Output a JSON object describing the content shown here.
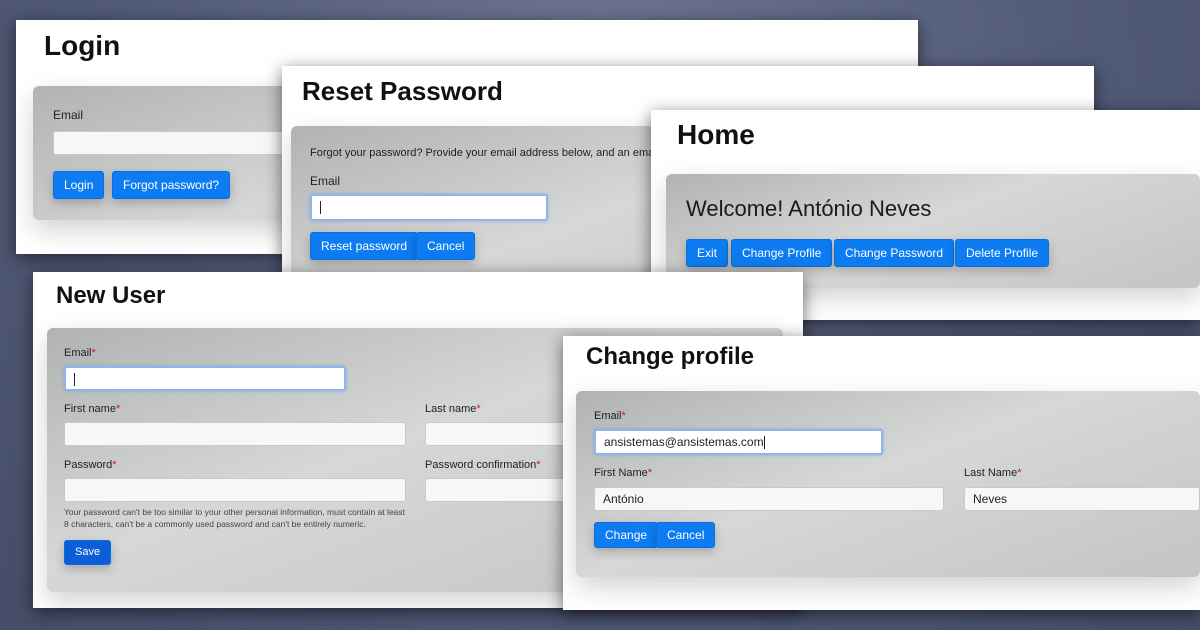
{
  "login": {
    "title": "Login",
    "email_label": "Email",
    "email_value": "",
    "login_button": "Login",
    "forgot_button": "Forgot password?"
  },
  "reset_password": {
    "title": "Reset Password",
    "description": "Forgot your password? Provide your email address below, and an ema",
    "email_label": "Email",
    "email_value": "",
    "reset_button": "Reset password",
    "cancel_button": "Cancel"
  },
  "home": {
    "title": "Home",
    "welcome": "Welcome! António Neves",
    "exit_button": "Exit",
    "change_profile_button": "Change Profile",
    "change_password_button": "Change Password",
    "delete_profile_button": "Delete Profile"
  },
  "new_user": {
    "title": "New User",
    "email_label": "Email",
    "first_name_label": "First name",
    "last_name_label": "Last name",
    "password_label": "Password",
    "password_confirmation_label": "Password confirmation",
    "required_mark": "*",
    "password_help_line1": "Your password can't be too similar to your other personal information, must contain at least",
    "password_help_line2": "8 characters, can't be a commonly used password and can't be entirely numeric.",
    "save_button": "Save"
  },
  "change_profile": {
    "title": "Change profile",
    "email_label": "Email",
    "email_value": "ansistemas@ansistemas.com",
    "first_name_label": "First Name",
    "first_name_value": "António",
    "last_name_label": "Last Name",
    "last_name_value": "Neves",
    "required_mark": "*",
    "change_button": "Change",
    "cancel_button": "Cancel"
  },
  "colors": {
    "primary_button": "#0d7cf2",
    "required": "#d11b1b",
    "background": "#525b78"
  }
}
